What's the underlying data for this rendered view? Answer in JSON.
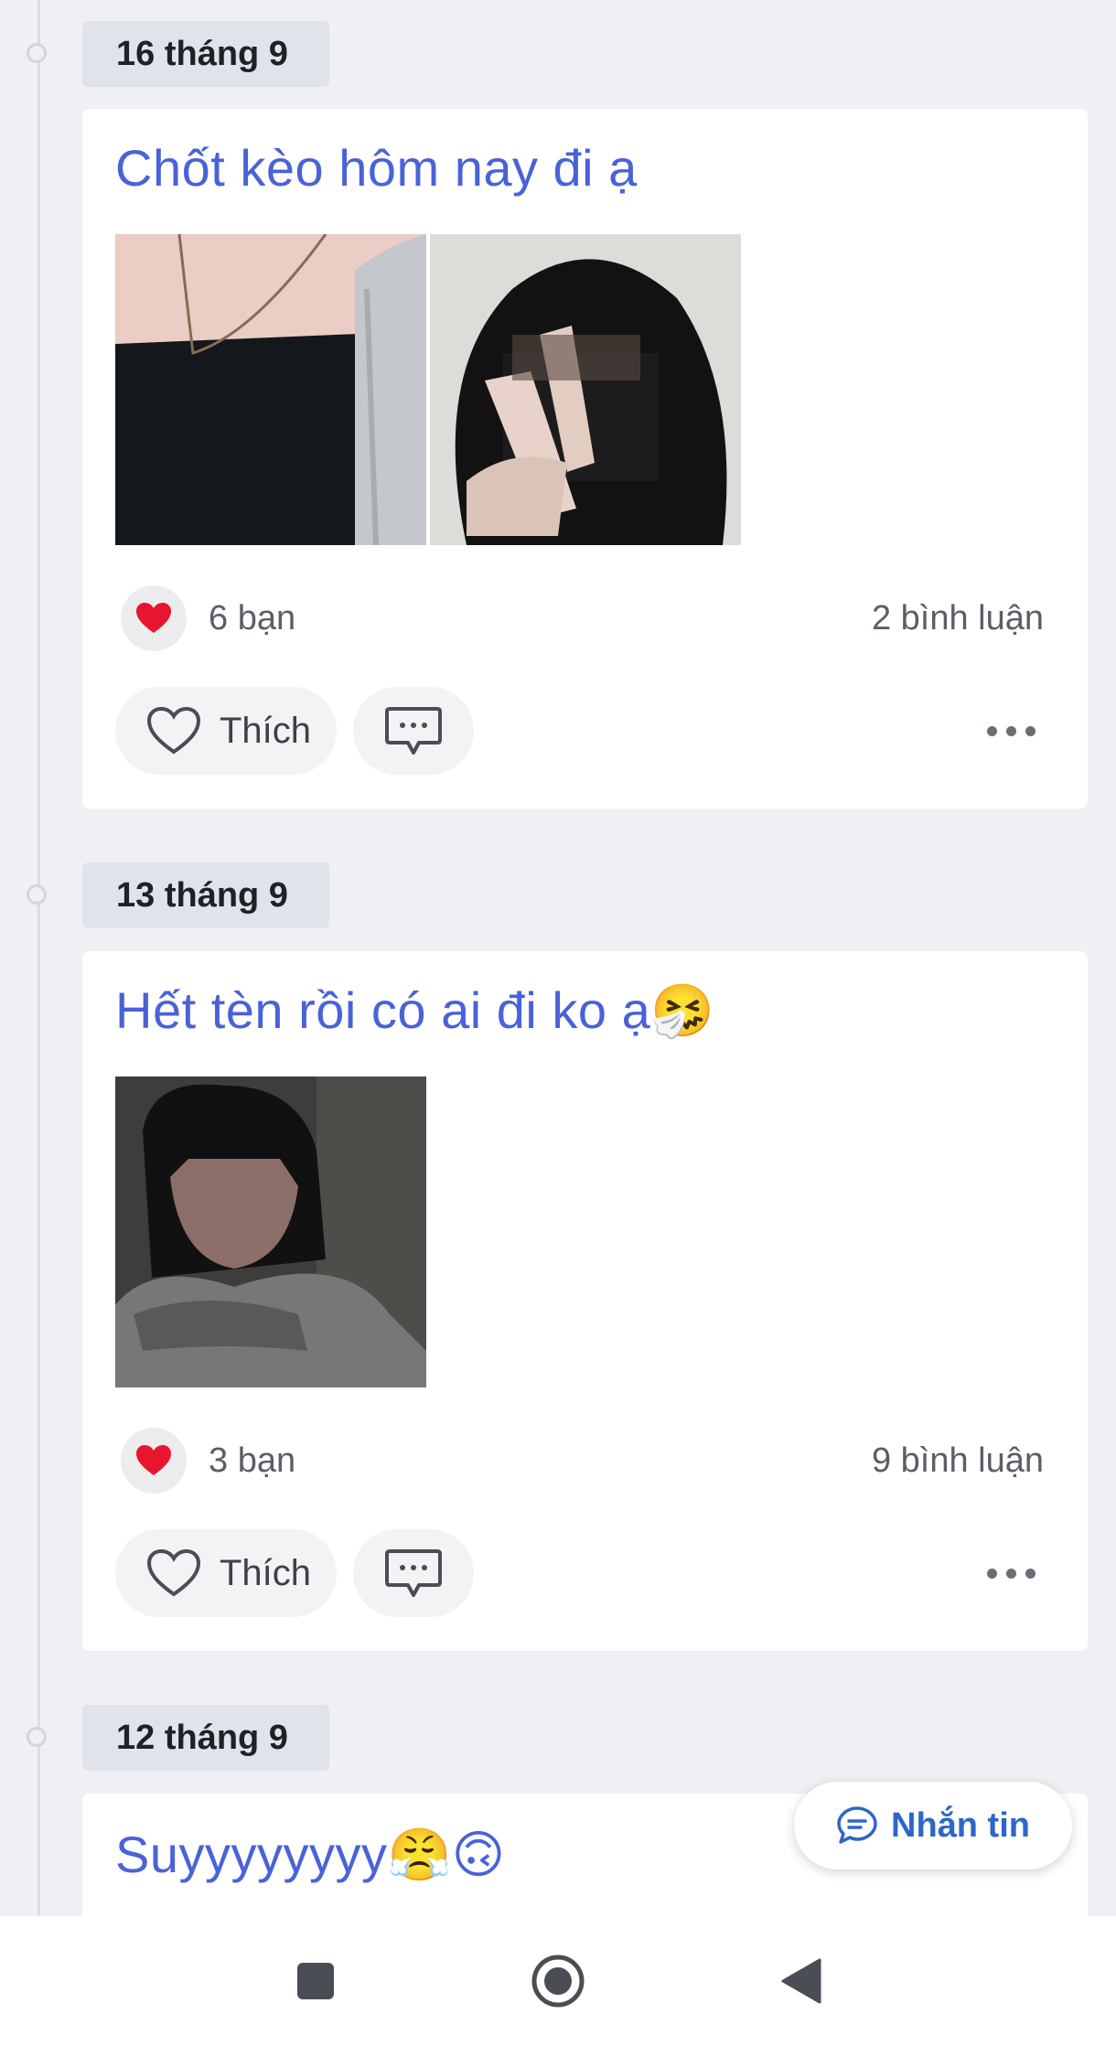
{
  "posts": [
    {
      "date": "16 tháng 9",
      "title": "Chốt kèo hôm nay đi ạ",
      "reaction_count": "6 bạn",
      "comment_count": "2 bình luận",
      "like_label": "Thích",
      "photos": [
        "photo-neck-necklace",
        "photo-hood-peace-sign"
      ]
    },
    {
      "date": "13 tháng 9",
      "title": "Hết tèn rồi có ai đi ko ạ🤧",
      "reaction_count": "3 bạn",
      "comment_count": "9 bình luận",
      "like_label": "Thích",
      "photos": [
        "photo-girl-sitting"
      ]
    },
    {
      "date": "12 tháng 9",
      "title": "Suyyyyyyyy😤🙃"
    }
  ],
  "fab": {
    "label": "Nhắn tin",
    "icon": "chat-bubble-icon"
  },
  "navbar": {
    "icons": [
      "square-recents-icon",
      "circle-home-icon",
      "triangle-back-icon"
    ]
  },
  "colors": {
    "accent": "#4a62d8",
    "fab_text": "#2f66c9",
    "background": "#eff0f4",
    "heart": "#e8152f"
  }
}
